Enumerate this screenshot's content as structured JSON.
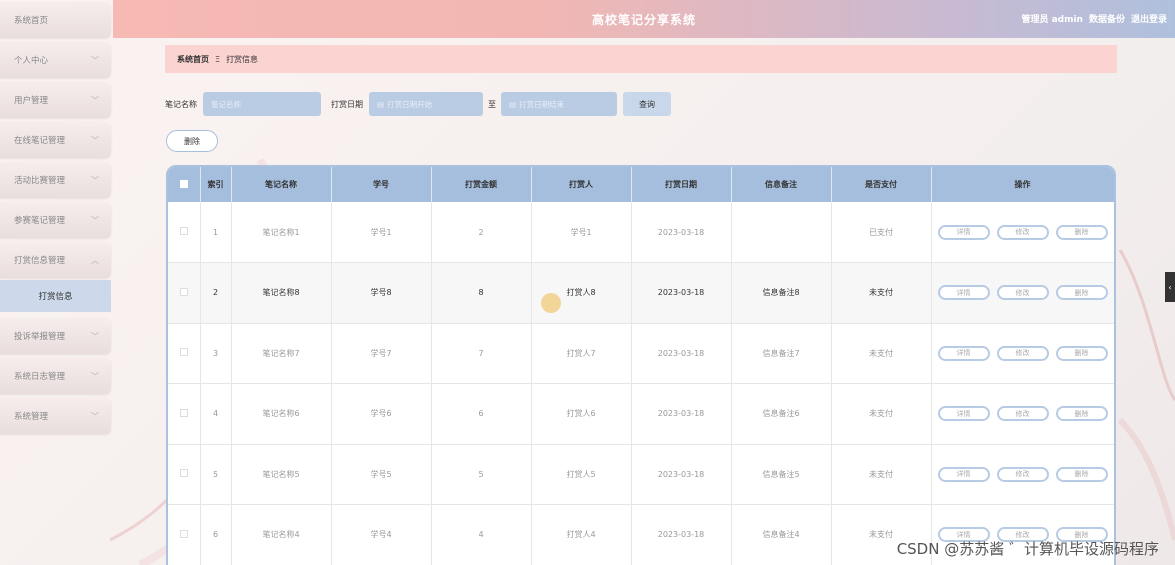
{
  "header": {
    "title": "高校笔记分享系统",
    "user": "管理员 admin",
    "backup": "数据备份",
    "logout": "退出登录"
  },
  "sidebar": {
    "items": [
      {
        "label": "系统首页",
        "expandable": false
      },
      {
        "label": "个人中心",
        "expandable": true
      },
      {
        "label": "用户管理",
        "expandable": true
      },
      {
        "label": "在线笔记管理",
        "expandable": true
      },
      {
        "label": "活动比赛管理",
        "expandable": true
      },
      {
        "label": "参赛笔记管理",
        "expandable": true
      },
      {
        "label": "打赏信息管理",
        "expandable": true,
        "expanded": true
      },
      {
        "label": "投诉举报管理",
        "expandable": true
      },
      {
        "label": "系统日志管理",
        "expandable": true
      },
      {
        "label": "系统管理",
        "expandable": true
      }
    ],
    "sub_item": "打赏信息"
  },
  "breadcrumb": {
    "home": "系统首页",
    "separator": "Ξ",
    "current": "打赏信息"
  },
  "search": {
    "note_name_label": "笔记名称",
    "note_name_placeholder": "笔记名称",
    "date_label": "打赏日期",
    "date_start_placeholder": "打赏日期开始",
    "date_to": "至",
    "date_end_placeholder": "打赏日期结束",
    "query_button": "查询"
  },
  "delete_button": "删除",
  "table": {
    "headers": [
      "索引",
      "笔记名称",
      "学号",
      "打赏金额",
      "打赏人",
      "打赏日期",
      "信息备注",
      "是否支付",
      "操作"
    ],
    "rows": [
      {
        "index": "1",
        "name": "笔记名称1",
        "sid": "学号1",
        "amount": "2",
        "payer": "学号1",
        "date": "2023-03-18",
        "note": "",
        "paid": "已支付"
      },
      {
        "index": "2",
        "name": "笔记名称8",
        "sid": "学号8",
        "amount": "8",
        "payer": "打赏人8",
        "date": "2023-03-18",
        "note": "信息备注8",
        "paid": "未支付"
      },
      {
        "index": "3",
        "name": "笔记名称7",
        "sid": "学号7",
        "amount": "7",
        "payer": "打赏人7",
        "date": "2023-03-18",
        "note": "信息备注7",
        "paid": "未支付"
      },
      {
        "index": "4",
        "name": "笔记名称6",
        "sid": "学号6",
        "amount": "6",
        "payer": "打赏人6",
        "date": "2023-03-18",
        "note": "信息备注6",
        "paid": "未支付"
      },
      {
        "index": "5",
        "name": "笔记名称5",
        "sid": "学号5",
        "amount": "5",
        "payer": "打赏人5",
        "date": "2023-03-18",
        "note": "信息备注5",
        "paid": "未支付"
      },
      {
        "index": "6",
        "name": "笔记名称4",
        "sid": "学号4",
        "amount": "4",
        "payer": "打赏人4",
        "date": "2023-03-18",
        "note": "信息备注4",
        "paid": "未支付"
      }
    ],
    "ops": {
      "detail": "详情",
      "edit": "修改",
      "delete": "删除"
    }
  },
  "watermark": "CSDN @苏苏酱 ゛计算机毕设源码程序",
  "colors": {
    "accent_blue": "#a5bedd",
    "header_pink": "#f6b9b4",
    "breadcrumb_pink": "#fbd3d1"
  }
}
